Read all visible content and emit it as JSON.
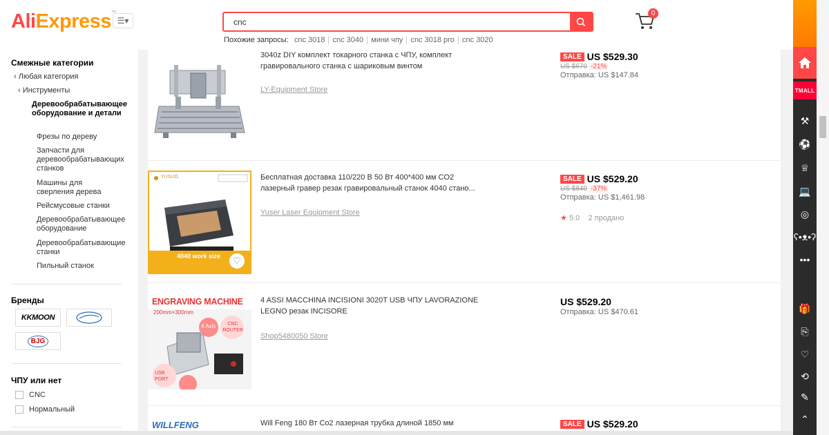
{
  "header": {
    "logo_ali": "Ali",
    "logo_express": "Express",
    "logo_tm": "™",
    "search_value": "cnc",
    "related_label": "Похожие запросы:",
    "related_tags": [
      "cnc 3018",
      "cnc 3040",
      "мини чпу",
      "cnc 3018 pro",
      "cnc 3020"
    ],
    "cart_count": "0"
  },
  "sidebar": {
    "related_title": "Смежные категории",
    "any_category": "Любая категория",
    "tools": "Инструменты",
    "current_category": "Деревообрабатывающее оборудование и детали",
    "subcategories": [
      "Фрезы по дереву",
      "Запчасти для деревообрабатывающих станков",
      "Машины для сверления дерева",
      "Рейсмусовые станки",
      "Деревообрабатывающее оборудование",
      "Деревообрабатывающие станки",
      "Пильный станок"
    ],
    "brands_title": "Бренды",
    "brands": [
      "KKMOON",
      "brand-2",
      "BJG"
    ],
    "cnc_title": "ЧПУ или нет",
    "cnc_options": [
      "CNC",
      "Нормальный"
    ]
  },
  "products": [
    {
      "title": "3040z DIY комплект токарного станка с ЧПУ, комплект гравировального станка с шариковым винтом",
      "store": "LY-Equipment Store",
      "sale": "SALE",
      "price": "US $529.30",
      "orig_price": "US $670",
      "discount": "-21%",
      "shipping": "Отправка: US $147.84"
    },
    {
      "title": "Бесплатная доставка 110/220 В 50 Вт 400*400 мм CO2 лазерный гравер резак гравировальный станок 4040 стано...",
      "store": "Yuser Laser Equipment Store",
      "sale": "SALE",
      "price": "US $529.20",
      "orig_price": "US $840",
      "discount": "-37%",
      "shipping": "Отправка: US $1,461.98",
      "rating": "5.0",
      "sold": "2 продано",
      "img_label": "4040 work size",
      "img_brand": "YUSUO"
    },
    {
      "title": "4 ASSI MACCHINA INCISIONI 3020T USB ЧПУ LAVORAZIONE LEGNO резак INCISORE",
      "store": "Shop5480050 Store",
      "price": "US $529.20",
      "shipping": "Отправка: US $470.61",
      "img_title": "ENGRAVING MACHINE",
      "img_size": "200mm×300mm",
      "img_axis": "4 Axis",
      "img_router": "CNC ROUTER",
      "img_usb": "USB PORT"
    },
    {
      "title": "Will Feng 180 Вт Co2 лазерная трубка длиной 1850 мм",
      "sale": "SALE",
      "price": "US $529.20",
      "img_brand": "WILLFENG"
    }
  ],
  "rightbar": {
    "tmall": "TMALL",
    "more": "•••"
  },
  "colors": {
    "brand_red": "#ff4747",
    "brand_orange": "#ff9900",
    "rightbar": "#2b2b2b"
  }
}
